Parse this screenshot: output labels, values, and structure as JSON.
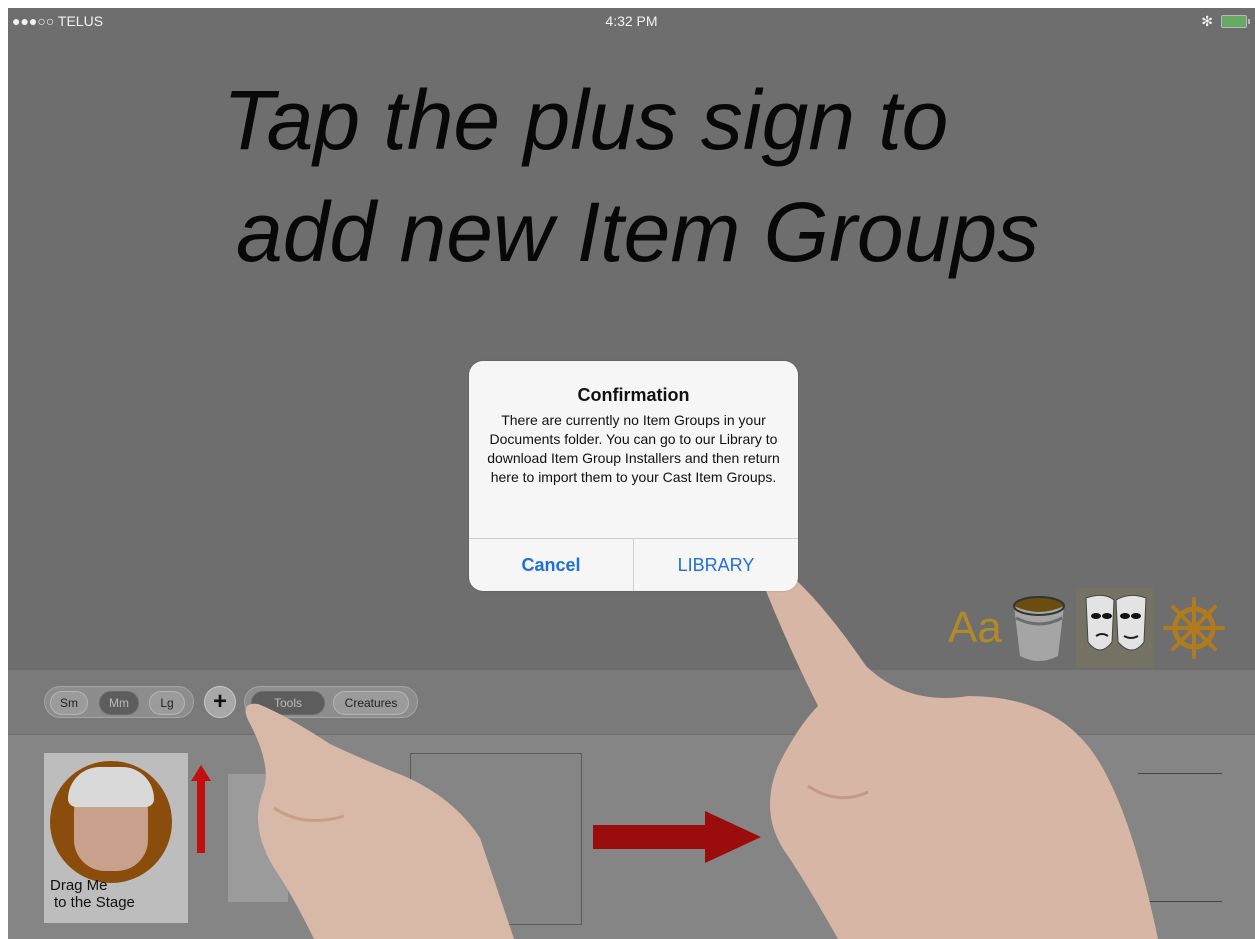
{
  "status_bar": {
    "carrier": "●●●○○ TELUS",
    "time": "4:32 PM",
    "bluetooth": "✻"
  },
  "headline": {
    "line1": "Tap the plus sign to",
    "line2": "add new Item Groups"
  },
  "dialog": {
    "title": "Confirmation",
    "message": "There are currently no Item Groups in your Documents folder. You can go to our Library to download Item Group Installers and then return here to import them to your Cast Item Groups.",
    "cancel_label": "Cancel",
    "library_label": "LIBRARY"
  },
  "size_segment": {
    "small": "Sm",
    "medium": "Mm",
    "large": "Lg",
    "selected": "Mm"
  },
  "category_segment": {
    "tools": "Tools",
    "creatures": "Creatures",
    "selected": "Tools"
  },
  "plus_symbol": "+",
  "avatar_card": {
    "label_line1": "Drag Me",
    "label_line2": "to the Stage"
  },
  "tool_icons": {
    "text_tool": "Aa",
    "icons": [
      "bucket-icon",
      "masks-icon",
      "ship-wheel-icon"
    ]
  },
  "colors": {
    "link_blue": "#1e6fd9",
    "arrow_red": "#9b0c0c",
    "gold": "#b08a2a"
  }
}
